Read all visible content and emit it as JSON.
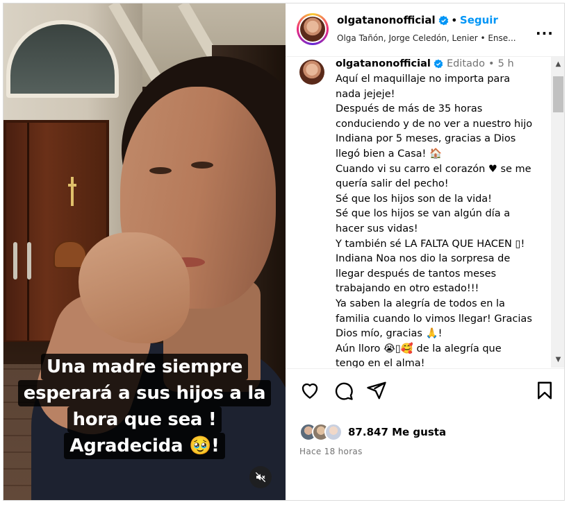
{
  "post": {
    "caption_overlay": [
      "Una madre siempre",
      "esperará a sus hijos a la",
      "hora que sea !",
      "Agradecida 🥹!"
    ]
  },
  "header": {
    "username": "olgatanonofficial",
    "follow_label": "Seguir",
    "dot": "•",
    "collaborators": "Olga Tañón, Jorge Celedón, Lenier • Ense...",
    "more_label": "..."
  },
  "comment": {
    "username": "olgatanonofficial",
    "edited": "Editado",
    "dot": "•",
    "age": "5 h",
    "lines": [
      "Aquí el maquillaje no importa para",
      "nada jejeje!",
      "Después de más de 35 horas",
      "conduciendo y de no ver a nuestro hijo",
      "Indiana por 5 meses, gracias a Dios",
      "llegó bien a Casa! 🏠",
      "Cuando vi su carro el corazón ♥ se me",
      "quería salir del pecho!",
      "Sé que los hijos son de la vida!",
      "Sé que los hijos se van algún día a",
      "hacer sus vidas!",
      "Y también sé LA FALTA QUE HACEN ▯!",
      "Indiana Noa nos dio la sorpresa de",
      "llegar después de tantos meses",
      "trabajando en otro estado!!!",
      "Ya saben la alegría de todos en la",
      "familia cuando lo vimos llegar! Gracias",
      "Dios mío, gracias 🙏!",
      "Aún lloro 😭▯🥰 de la alegría que",
      "tengo en el alma!"
    ]
  },
  "scrollbar": {
    "up": "▲",
    "down": "▼"
  },
  "footer": {
    "likes": "87.847 Me gusta",
    "time": "Hace 18 horas"
  },
  "icons": [
    "verified-badge-icon",
    "more-options-icon",
    "heart-icon",
    "comment-icon",
    "share-icon",
    "bookmark-icon",
    "mute-icon"
  ],
  "colors": {
    "accent": "#0095f6",
    "verified": "#0095f6",
    "muted_text": "#737373"
  }
}
